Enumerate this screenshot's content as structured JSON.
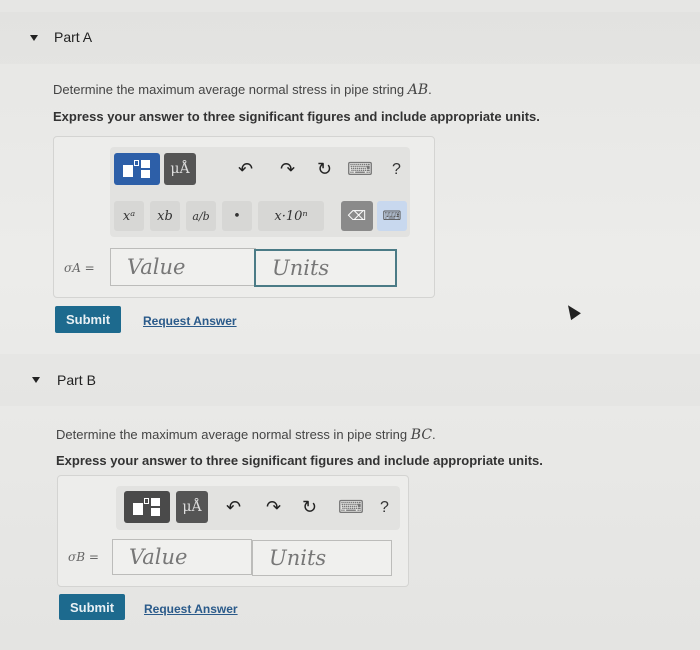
{
  "part_a": {
    "title": "Part A",
    "question_prefix": "Determine the maximum average normal stress in pipe string ",
    "question_var": "AB",
    "question_suffix": ".",
    "instruction": "Express your answer to three significant figures and include appropriate units.",
    "variable_label": "σA =",
    "value_placeholder": "Value",
    "units_placeholder": "Units",
    "toolbar": {
      "units_button": "μÅ",
      "help": "?",
      "keys": [
        "xᵃ",
        "xb",
        "a/b",
        "•",
        "x·10ⁿ"
      ]
    },
    "submit_label": "Submit",
    "request_answer_label": "Request Answer"
  },
  "part_b": {
    "title": "Part B",
    "question_prefix": "Determine the maximum average normal stress in pipe string ",
    "question_var": "BC",
    "question_suffix": ".",
    "instruction": "Express your answer to three significant figures and include appropriate units.",
    "variable_label": "σB =",
    "value_placeholder": "Value",
    "units_placeholder": "Units",
    "toolbar": {
      "units_button": "μÅ",
      "help": "?"
    },
    "submit_label": "Submit",
    "request_answer_label": "Request Answer"
  },
  "icons": {
    "undo": "↶",
    "redo": "↷",
    "reset": "↻",
    "keyboard": "⌨",
    "backspace": "⌫"
  }
}
